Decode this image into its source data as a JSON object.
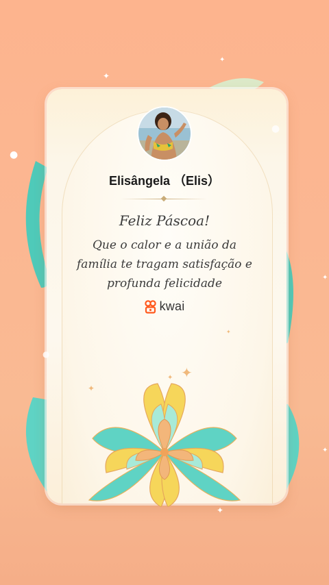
{
  "profile": {
    "name": "Elisângela （Elis）"
  },
  "card": {
    "greeting": "Feliz Páscoa!",
    "message_lines": [
      "Que o calor e a união da",
      "família te tragam satisfação e",
      "profunda felicidade"
    ]
  },
  "brand": {
    "logo_text": "kwai",
    "logo_icon": "kwai-logo-icon",
    "color": "#ff5a1f"
  },
  "colors": {
    "background": "#fbb792",
    "card": "#fdf7ec",
    "ribbon_teal": "#5fd3c4",
    "petal_yellow": "#f6d65a",
    "petal_orange": "#f3b67a"
  }
}
